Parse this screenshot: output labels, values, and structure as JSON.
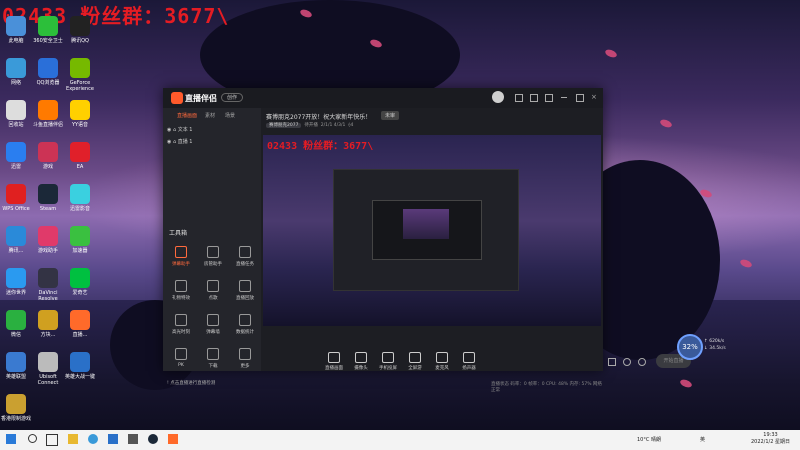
{
  "overlay": {
    "text": "02433 粉丝群：3677\\"
  },
  "desktop": {
    "icons": [
      {
        "label": "此电脑",
        "color": "#4a90d9"
      },
      {
        "label": "360安全卫士",
        "color": "#2cbf3a"
      },
      {
        "label": "腾讯QQ",
        "color": "#222"
      },
      {
        "label": "网络",
        "color": "#3a9ad9"
      },
      {
        "label": "QQ浏览器",
        "color": "#2a6fd9"
      },
      {
        "label": "GeForce Experience",
        "color": "#76b900"
      },
      {
        "label": "回收站",
        "color": "#ddd"
      },
      {
        "label": "斗鱼直播伴侣",
        "color": "#ff7a00"
      },
      {
        "label": "YY语音",
        "color": "#ffd000"
      },
      {
        "label": "迅雷",
        "color": "#2a7ef0"
      },
      {
        "label": "游戏",
        "color": "#cc3355"
      },
      {
        "label": "EA",
        "color": "#e0202a"
      },
      {
        "label": "WPS Office",
        "color": "#e02020"
      },
      {
        "label": "Steam",
        "color": "#1b2838"
      },
      {
        "label": "迅雷影音",
        "color": "#3ad0e0"
      },
      {
        "label": "腾讯...",
        "color": "#2a8ad9"
      },
      {
        "label": "游戏助手",
        "color": "#e03a6a"
      },
      {
        "label": "加速器",
        "color": "#3ac040"
      },
      {
        "label": "迷你世界",
        "color": "#2a9af0"
      },
      {
        "label": "DaVinci Resolve",
        "color": "#334"
      },
      {
        "label": "爱奇艺",
        "color": "#00c040"
      },
      {
        "label": "微信",
        "color": "#2ab040"
      },
      {
        "label": "方块...",
        "color": "#d0a020"
      },
      {
        "label": "直播...",
        "color": "#ff6a2a"
      },
      {
        "label": "英雄联盟",
        "color": "#3a7ad0"
      },
      {
        "label": "Ubisoft Connect",
        "color": "#bbb"
      },
      {
        "label": "英雄大战一键",
        "color": "#2a70c8"
      },
      {
        "label": "香港限制游戏",
        "color": "#caa030"
      }
    ]
  },
  "app": {
    "name": "直播伴侣",
    "pill": "创作",
    "source_tabs": [
      "直播画面",
      "素材",
      "场景"
    ],
    "sources": [
      "文本 1",
      "直播 1"
    ],
    "tools_heading": "工具箱",
    "tools": [
      {
        "label": "弹幕助手",
        "hot": true
      },
      {
        "label": "房管助手",
        "hot": false
      },
      {
        "label": "直播任务",
        "hot": false
      },
      {
        "label": "礼物特效",
        "hot": false
      },
      {
        "label": "点歌",
        "hot": false
      },
      {
        "label": "直播回放",
        "hot": false
      },
      {
        "label": "高光时刻",
        "hot": false
      },
      {
        "label": "弹幕墙",
        "hot": false
      },
      {
        "label": "数据统计",
        "hot": false
      },
      {
        "label": "PK",
        "hot": false
      },
      {
        "label": "下载",
        "hot": false
      },
      {
        "label": "更多",
        "hot": false
      }
    ],
    "bottom_note": "! 点击直播进行直播检测",
    "title": "赛博朋克2077开放！祝大家新年快乐！",
    "moderation_badge": "未审",
    "meta": {
      "category": "赛博朋克2077",
      "status": "待开播",
      "date": "2/1/1 4/3/1",
      "count": "4"
    },
    "preview_overlay": "02433 粉丝群：3677\\",
    "controls": [
      "直播画面",
      "摄像头",
      "手机投屏",
      "全屏游",
      "麦克风",
      "扬声器"
    ],
    "start_button": "开始直播",
    "stats": "直播状态    码率：0  帧率：0   CPU: 48%  内存: 57%  网络正常"
  },
  "widget": {
    "percent": "32%",
    "up": "620k/s",
    "down": "34.5k/s"
  },
  "taskbar": {
    "clock_time": "19:33",
    "clock_date": "2022/1/2 星期日",
    "weather": "10°C 晴朗",
    "lang": "英"
  }
}
